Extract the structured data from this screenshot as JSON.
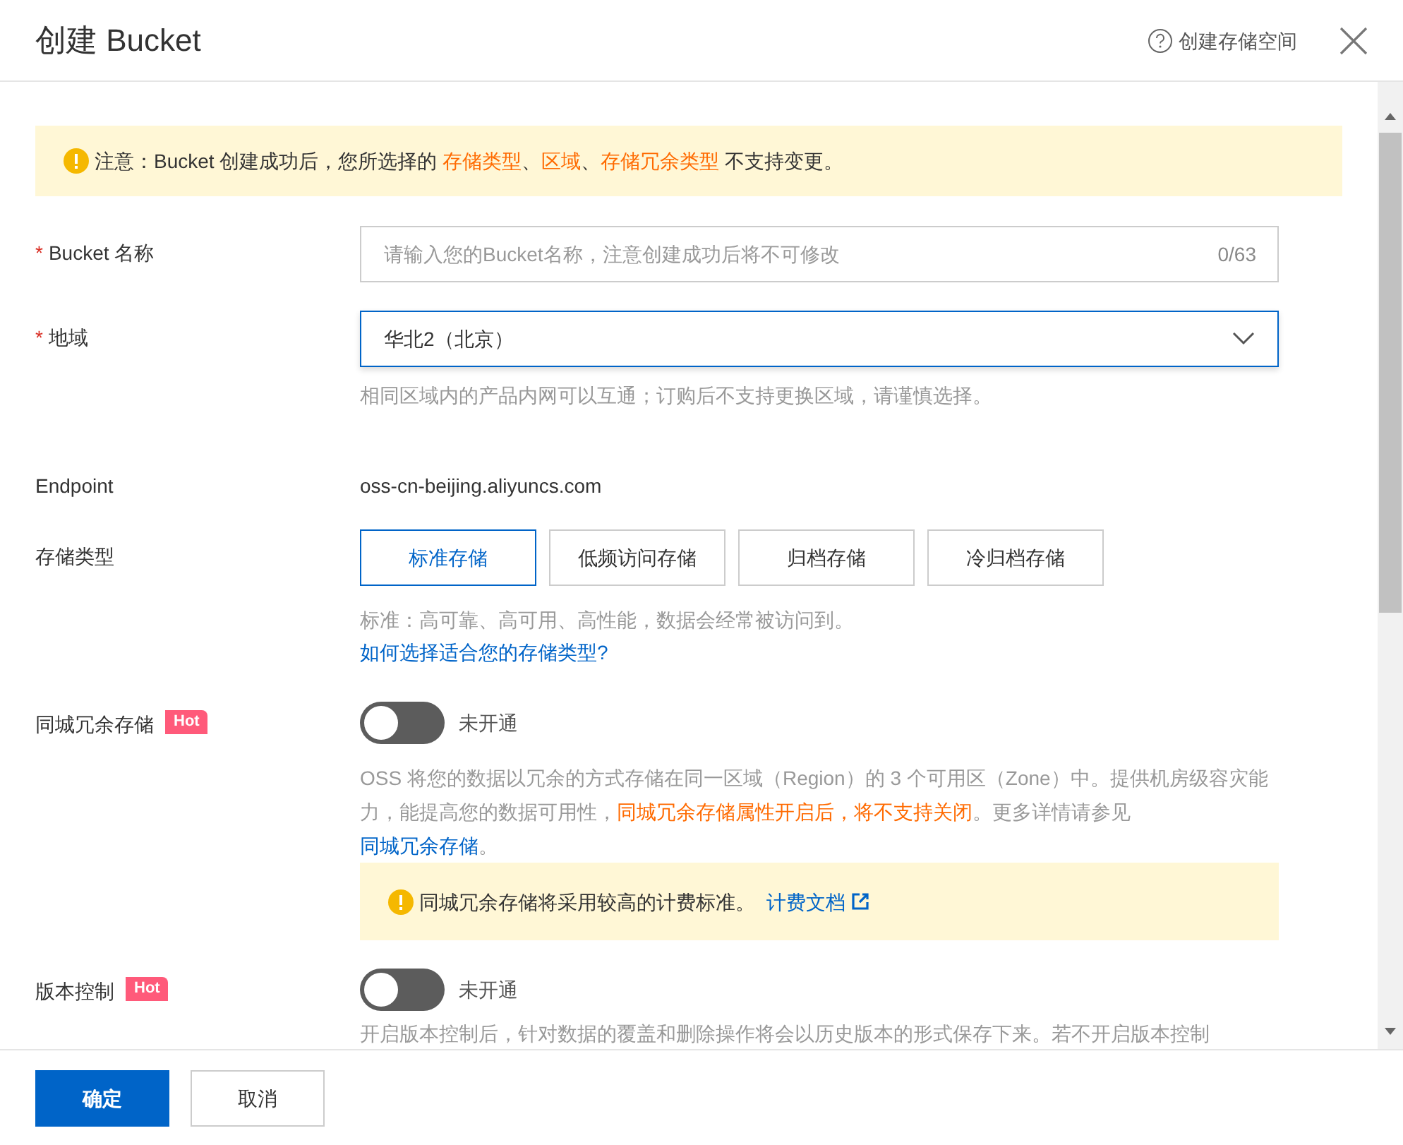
{
  "header": {
    "title": "创建 Bucket",
    "help_link": "创建存储空间"
  },
  "notice": {
    "segments": [
      {
        "kind": "text",
        "text": "注意：Bucket 创建成功后，您所选择的 "
      },
      {
        "kind": "highlight",
        "text": "存储类型"
      },
      {
        "kind": "text",
        "text": "、"
      },
      {
        "kind": "highlight",
        "text": "区域"
      },
      {
        "kind": "text",
        "text": "、"
      },
      {
        "kind": "highlight",
        "text": "存储冗余类型"
      },
      {
        "kind": "text",
        "text": " 不支持变更。"
      }
    ]
  },
  "bucket_name": {
    "required_mark": "*",
    "label": "Bucket 名称",
    "placeholder": "请输入您的Bucket名称，注意创建成功后将不可修改",
    "counter": "0/63"
  },
  "region": {
    "required_mark": "*",
    "label": "地域",
    "value": "华北2（北京）",
    "hint": "相同区域内的产品内网可以互通；订购后不支持更换区域，请谨慎选择。"
  },
  "endpoint": {
    "label": "Endpoint",
    "value": "oss-cn-beijing.aliyuncs.com"
  },
  "storage_class": {
    "label": "存储类型",
    "options": [
      {
        "label": "标准存储",
        "selected": true
      },
      {
        "label": "低频访问存储",
        "selected": false
      },
      {
        "label": "归档存储",
        "selected": false
      },
      {
        "label": "冷归档存储",
        "selected": false
      }
    ],
    "hint": "标准：高可靠、高可用、高性能，数据会经常被访问到。",
    "link": "如何选择适合您的存储类型?"
  },
  "redundancy": {
    "label": "同城冗余存储",
    "badge": "Hot",
    "on": false,
    "status": "未开通",
    "description": [
      {
        "kind": "text",
        "text": "OSS 将您的数据以冗余的方式存储在同一区域（Region）的 3 个可用区（Zone）中。提供机房级容灾能力，能提高您的数据可用性，"
      },
      {
        "kind": "highlight",
        "text": "同城冗余存储属性开启后，将不支持关闭"
      },
      {
        "kind": "text",
        "text": "。更多详情请参见 "
      },
      {
        "kind": "link",
        "text": "同城冗余存储"
      },
      {
        "kind": "text",
        "text": "。"
      }
    ],
    "warning": "同城冗余存储将采用较高的计费标准。",
    "warning_link": "计费文档"
  },
  "versioning": {
    "label": "版本控制",
    "badge": "Hot",
    "on": false,
    "status": "未开通",
    "description": "开启版本控制后，针对数据的覆盖和删除操作将会以历史版本的形式保存下来。若不开启版本控制"
  },
  "footer": {
    "buttons": [
      {
        "kind": "primary",
        "label": "确定"
      },
      {
        "kind": "default",
        "label": "取消"
      }
    ]
  }
}
